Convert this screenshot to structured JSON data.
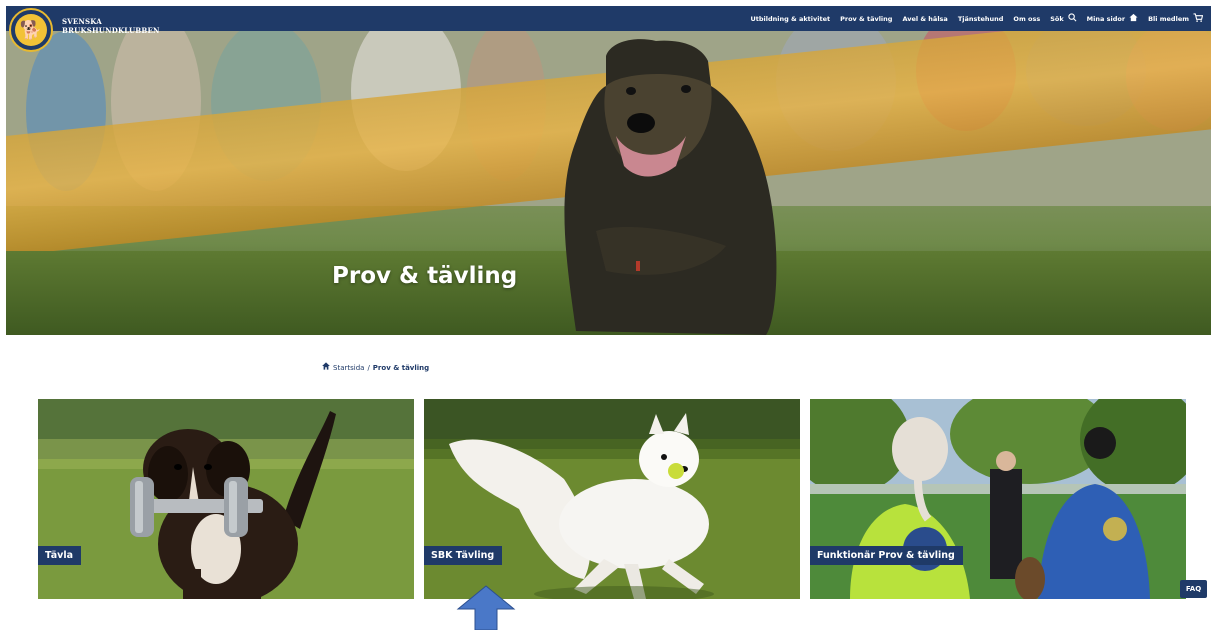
{
  "header": {
    "brand_line1": "SVENSKA",
    "brand_line2": "BRUKSHUNDKLUBBEN",
    "nav": [
      {
        "label": "Utbildning & aktivitet"
      },
      {
        "label": "Prov & tävling"
      },
      {
        "label": "Avel & hälsa"
      },
      {
        "label": "Tjänstehund"
      },
      {
        "label": "Om oss"
      },
      {
        "label": "Sök",
        "icon": "search-icon"
      },
      {
        "label": "Mina sidor",
        "icon": "home-icon"
      },
      {
        "label": "Bli medlem",
        "icon": "cart-icon"
      }
    ]
  },
  "hero": {
    "title": "Prov & tävling"
  },
  "breadcrumb": {
    "home": "Startsida",
    "separator": "/",
    "current": "Prov & tävling"
  },
  "cards": [
    {
      "label": "Tävla"
    },
    {
      "label": "SBK Tävling"
    },
    {
      "label": "Funktionär Prov & tävling"
    }
  ],
  "faq": {
    "label": "FAQ"
  },
  "colors": {
    "brand": "#1f3a68",
    "accent": "#f2c236",
    "arrow": "#4a78c8"
  }
}
